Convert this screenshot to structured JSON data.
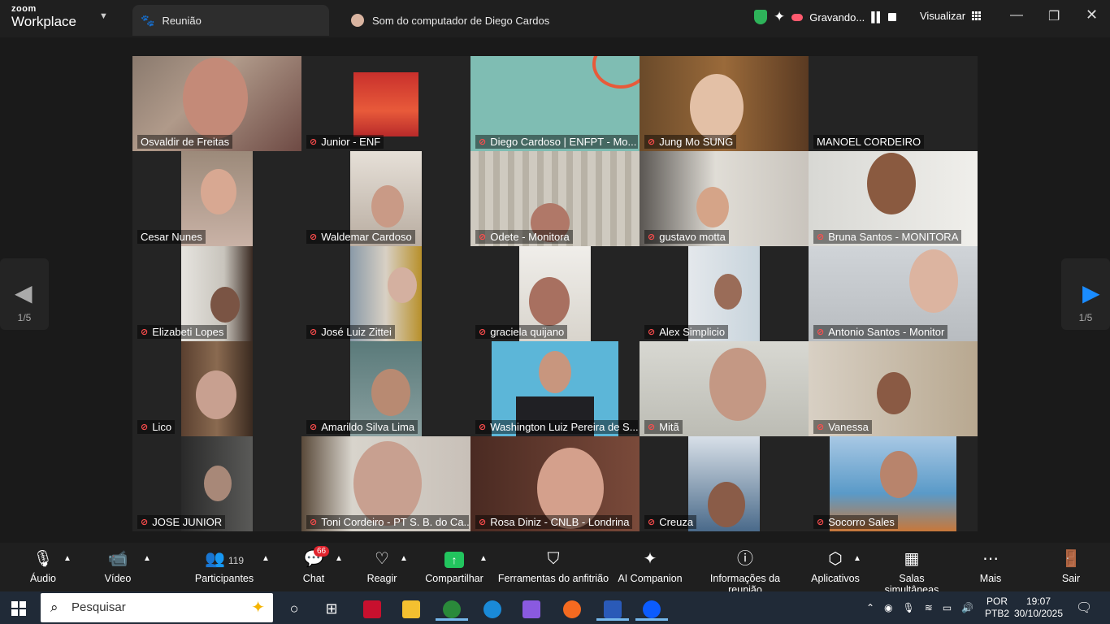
{
  "app": {
    "brand_small": "zoom",
    "brand_large": "Workplace"
  },
  "tabs": [
    {
      "label": "Reunião"
    },
    {
      "label": "Som do computador de Diego Cardos"
    }
  ],
  "recording": {
    "label": "Gravando..."
  },
  "view": {
    "label": "Visualizar"
  },
  "pagination": {
    "left": "1/5",
    "right": "1/5"
  },
  "participants": [
    {
      "name": "Osvaldir de Freitas"
    },
    {
      "name": "Junior - ENF"
    },
    {
      "name": "Diego Cardoso | ENFPT - Mo..."
    },
    {
      "name": "Jung Mo SUNG"
    },
    {
      "name": "MANOEL CORDEIRO"
    },
    {
      "name": "Cesar Nunes"
    },
    {
      "name": "Waldemar Cardoso"
    },
    {
      "name": "Odete - Monitora"
    },
    {
      "name": "gustavo motta"
    },
    {
      "name": "Bruna Santos - MONITORA"
    },
    {
      "name": "Elizabeti Lopes"
    },
    {
      "name": "José Luiz Zittei"
    },
    {
      "name": "graciela quijano"
    },
    {
      "name": "Alex Simplicio"
    },
    {
      "name": "Antonio Santos - Monitor"
    },
    {
      "name": "Lico"
    },
    {
      "name": "Amarildo Silva Lima"
    },
    {
      "name": "Washington Luiz Pereira de S..."
    },
    {
      "name": "Mitã"
    },
    {
      "name": "Vanessa"
    },
    {
      "name": "JOSE JUNIOR"
    },
    {
      "name": "Toni Cordeiro - PT S. B. do Ca..."
    },
    {
      "name": "Rosa Diniz - CNLB - Londrina"
    },
    {
      "name": "Creuza"
    },
    {
      "name": "Socorro Sales"
    }
  ],
  "toolbar": {
    "audio": "Áudio",
    "video": "Vídeo",
    "participants": "Participantes",
    "participants_count": "119",
    "chat": "Chat",
    "chat_badge": "66",
    "react": "Reagir",
    "share": "Compartilhar",
    "host_tools": "Ferramentas do anfitrião",
    "ai": "AI Companion",
    "info": "Informações da reunião",
    "apps": "Aplicativos",
    "rooms": "Salas simultâneas",
    "more": "Mais",
    "leave": "Sair"
  },
  "taskbar": {
    "search_placeholder": "Pesquisar",
    "lang1": "POR",
    "lang2": "PTB2",
    "time": "19:07",
    "date": "30/10/2025"
  },
  "colors": {
    "accent": "#3ce087",
    "blue": "#1a8cff",
    "muted_mic": "#ff4d4d",
    "recording": "#ff5a6e"
  }
}
